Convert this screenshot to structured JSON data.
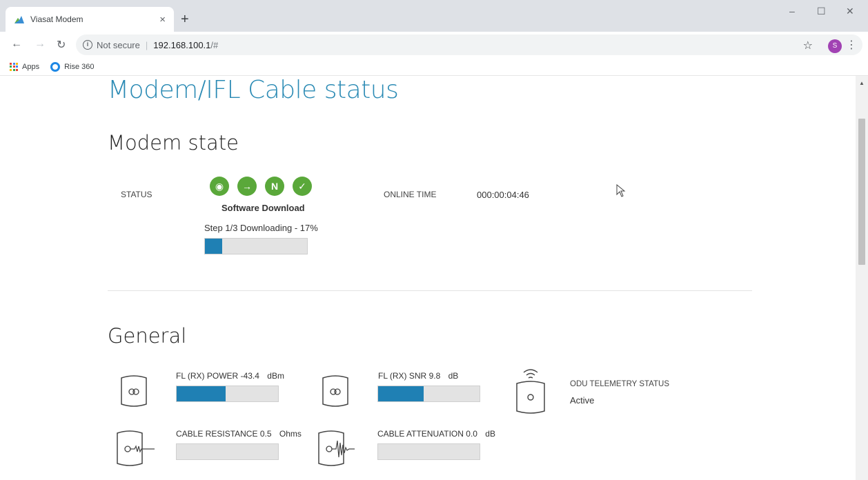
{
  "browser": {
    "tab_title": "Viasat Modem",
    "tab_close": "×",
    "new_tab": "+",
    "not_secure": "Not secure",
    "url_sep": "|",
    "url_host": "192.168.100.1",
    "url_path": "/#",
    "avatar_letter": "S",
    "bookmarks": [
      {
        "label": "Apps",
        "icon": "apps-grid-icon"
      },
      {
        "label": "Rise 360",
        "icon": "rise-360-icon"
      }
    ],
    "colors": {
      "tabstrip": "#dee1e6",
      "omnibox": "#f1f3f4",
      "avatar": "#a142b3"
    }
  },
  "page": {
    "title": "Modem/IFL Cable status",
    "accent_color": "#2a8ab4",
    "modem_state": {
      "heading": "Modem state",
      "status_label": "STATUS",
      "status_icons": [
        "receive-icon",
        "transmit-icon",
        "network-icon",
        "check-icon"
      ],
      "status_color": "#5aa83a",
      "status_text": "Software Download",
      "step_text": "Step 1/3 Downloading - 17%",
      "progress_fraction": 0.17,
      "online_time_label": "ONLINE TIME",
      "online_time": "000:00:04:46"
    },
    "general": {
      "heading": "General",
      "fl_power_label": "FL (RX) POWER",
      "fl_power_value": "-43.4",
      "fl_power_unit": "dBm",
      "fl_power_fraction": 0.48,
      "fl_snr_label": "FL (RX) SNR",
      "fl_snr_value": "9.8",
      "fl_snr_unit": "dB",
      "fl_snr_fraction": 0.45,
      "odu_label": "ODU TELEMETRY STATUS",
      "odu_value": "Active",
      "cable_res_label": "CABLE RESISTANCE",
      "cable_res_value": "0.5",
      "cable_res_unit": "Ohms",
      "cable_res_fraction": 0,
      "cable_att_label": "CABLE ATTENUATION",
      "cable_att_value": "0.0",
      "cable_att_unit": "dB",
      "cable_att_fraction": 0,
      "bar_color": "#1f80b4"
    }
  }
}
